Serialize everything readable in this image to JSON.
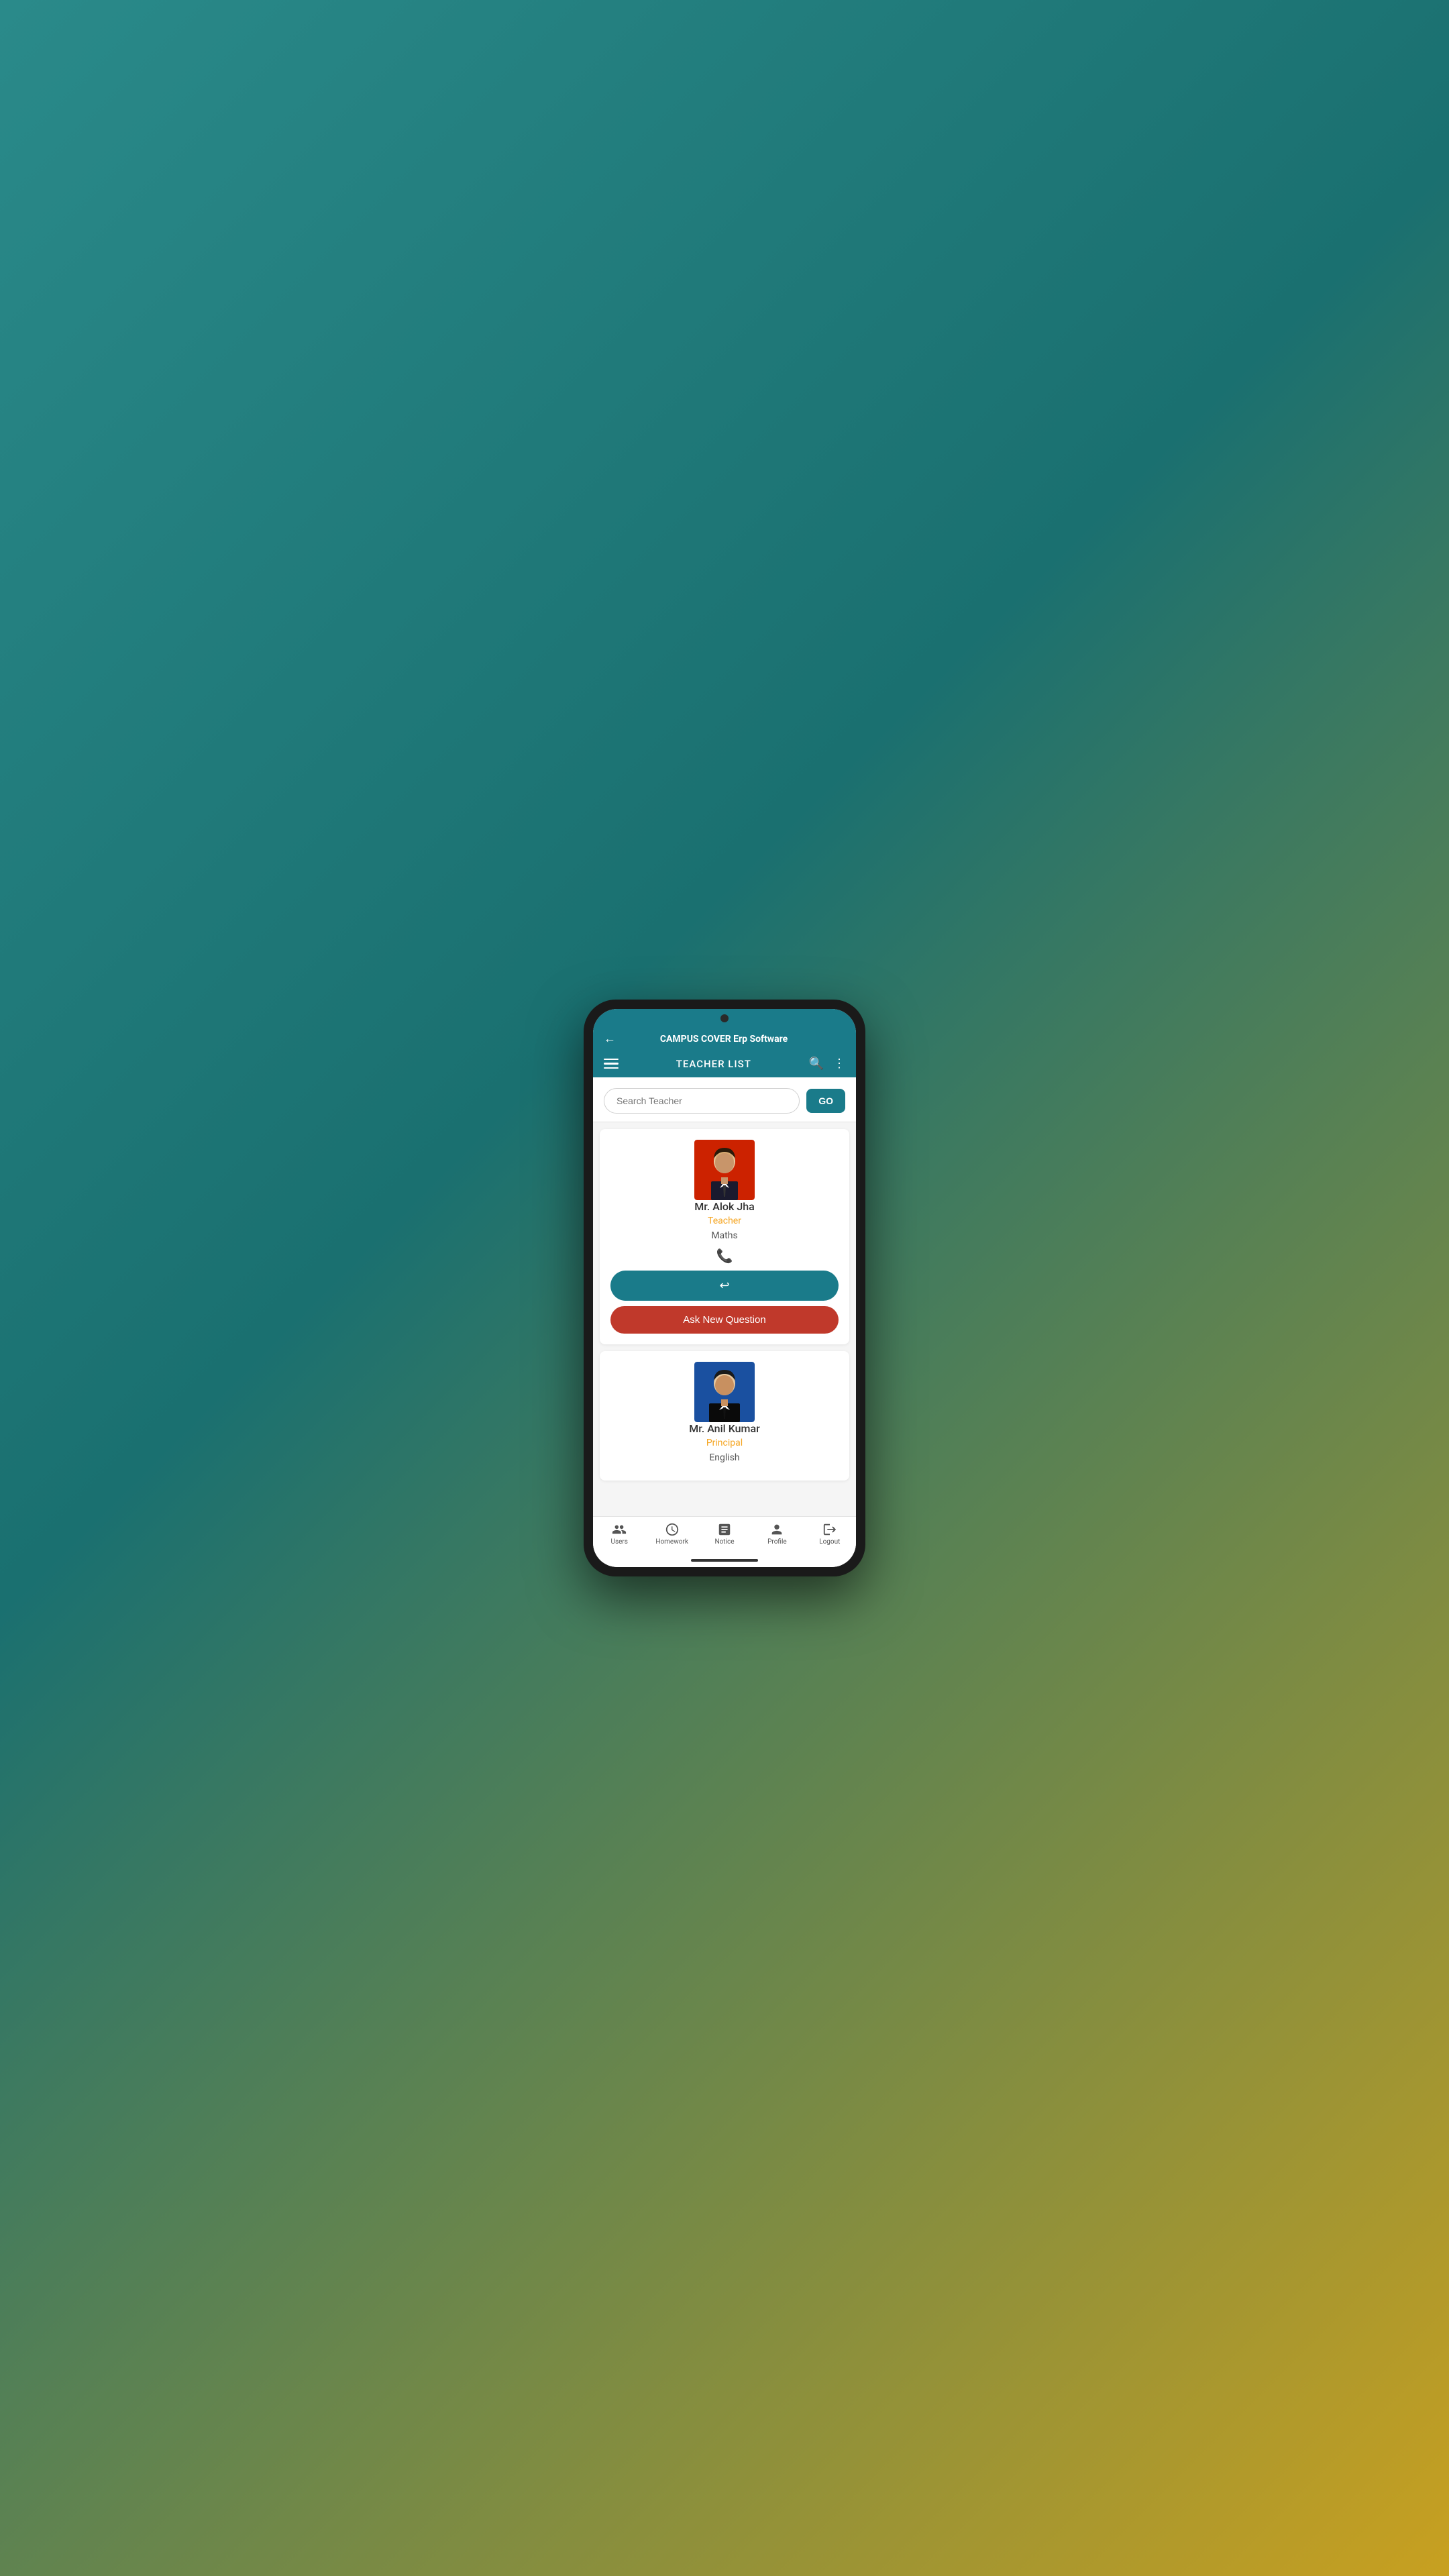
{
  "app": {
    "title": "CAMPUS COVER Erp Software",
    "screen_title": "TEACHER LIST"
  },
  "search": {
    "placeholder": "Search Teacher",
    "go_label": "GO"
  },
  "teachers": [
    {
      "name": "Mr. Alok Jha",
      "role": "Teacher",
      "subject": "Maths",
      "photo_bg": "red",
      "id": "teacher-1"
    },
    {
      "name": "Mr. Anil Kumar",
      "role": "Principal",
      "subject": "English",
      "photo_bg": "blue",
      "id": "teacher-2"
    }
  ],
  "buttons": {
    "reply_label": "↩",
    "ask_question_label": "Ask New Question"
  },
  "bottom_nav": [
    {
      "icon": "👥",
      "label": "Users",
      "name": "users"
    },
    {
      "icon": "🕐",
      "label": "Homework",
      "name": "homework"
    },
    {
      "icon": "📋",
      "label": "Notice",
      "name": "notice"
    },
    {
      "icon": "👤",
      "label": "Profile",
      "name": "profile"
    },
    {
      "icon": "🚪",
      "label": "Logout",
      "name": "logout"
    }
  ],
  "colors": {
    "primary": "#1a7b8a",
    "accent_orange": "#f5a623",
    "danger_red": "#c0392b",
    "text_dark": "#333333",
    "text_light": "#555555"
  }
}
